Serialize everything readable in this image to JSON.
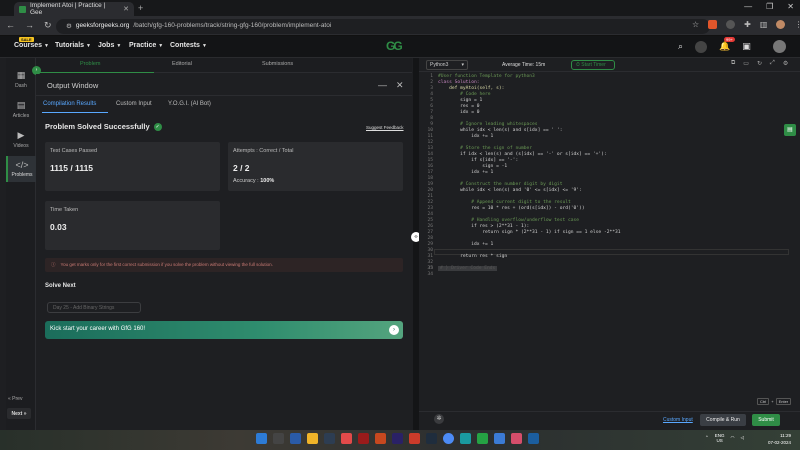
{
  "browser": {
    "tab_title": "Implement Atoi | Practice | Gee",
    "url_host": "geeksforgeeks.org",
    "url_path": "/batch/gfg-160-problems/track/string-gfg-160/problem/implement-atoi"
  },
  "site_nav": {
    "sale_badge": "SALE",
    "menus": [
      "Courses",
      "Tutorials",
      "Jobs",
      "Practice",
      "Contests"
    ],
    "logo": "GG",
    "notif_count": "99+"
  },
  "sidebar": {
    "items": [
      {
        "label": "Dash",
        "icon": "dash-icon"
      },
      {
        "label": "Articles",
        "icon": "articles-icon"
      },
      {
        "label": "Videos",
        "icon": "videos-icon"
      },
      {
        "label": "Problems",
        "icon": "code-icon"
      }
    ],
    "prev": "« Prev",
    "next": "Next »"
  },
  "problem_tabs": [
    "Problem",
    "Editorial",
    "Submissions"
  ],
  "output": {
    "title": "Output Window",
    "tabs": [
      "Compilation Results",
      "Custom Input",
      "Y.O.G.I. (AI Bot)"
    ],
    "status": "Problem Solved Successfully",
    "suggest_feedback": "Suggest Feedback",
    "test_cases_label": "Test Cases Passed",
    "test_cases_value": "1115 / 1115",
    "attempts_label": "Attempts : Correct / Total",
    "attempts_value": "2 / 2",
    "accuracy_label": "Accuracy :",
    "accuracy_value": "100%",
    "time_label": "Time Taken",
    "time_value": "0.03",
    "warning": "You get marks only for the first correct submission if you solve the problem without viewing the full solution.",
    "solve_next": "Solve Next",
    "next_problem": "Day 25 - Add Binary Strings",
    "banner": "Kick start your career with GfG 160!"
  },
  "editor": {
    "language": "Python3",
    "avg_time": "Average Time: 15m",
    "timer": "Start Timer",
    "custom_input": "Custom Input",
    "compile_run": "Compile & Run",
    "submit": "Submit",
    "shortcut_1": "Ctrl",
    "shortcut_2": "Enter",
    "ghost_line": "# } Driver Code Ends"
  },
  "code_lines": [
    {
      "n": "1",
      "t": "#User function Template for python3",
      "c": "cm"
    },
    {
      "n": "2",
      "t": "class Solution:",
      "c": "kw"
    },
    {
      "n": "3",
      "t": "    def myAtoi(self, s):",
      "c": "fn"
    },
    {
      "n": "4",
      "t": "        # Code here",
      "c": "cm"
    },
    {
      "n": "5",
      "t": "        sign = 1",
      "c": "tx"
    },
    {
      "n": "6",
      "t": "        res = 0",
      "c": "tx"
    },
    {
      "n": "7",
      "t": "        idx = 0",
      "c": "tx"
    },
    {
      "n": "8",
      "t": "",
      "c": "tx"
    },
    {
      "n": "9",
      "t": "        # Ignore leading whitespaces",
      "c": "cm"
    },
    {
      "n": "10",
      "t": "        while idx < len(s) and s[idx] == ' ':",
      "c": "tx"
    },
    {
      "n": "11",
      "t": "            idx += 1",
      "c": "tx"
    },
    {
      "n": "12",
      "t": "",
      "c": "tx"
    },
    {
      "n": "13",
      "t": "        # Store the sign of number",
      "c": "cm"
    },
    {
      "n": "14",
      "t": "        if idx < len(s) and (s[idx] == '-' or s[idx] == '+'):",
      "c": "tx"
    },
    {
      "n": "15",
      "t": "            if s[idx] == '-':",
      "c": "tx"
    },
    {
      "n": "16",
      "t": "                sign = -1",
      "c": "tx"
    },
    {
      "n": "17",
      "t": "            idx += 1",
      "c": "tx"
    },
    {
      "n": "18",
      "t": "",
      "c": "tx"
    },
    {
      "n": "19",
      "t": "        # Construct the number digit by digit",
      "c": "cm"
    },
    {
      "n": "20",
      "t": "        while idx < len(s) and '0' <= s[idx] <= '9':",
      "c": "tx"
    },
    {
      "n": "21",
      "t": "",
      "c": "tx"
    },
    {
      "n": "22",
      "t": "            # Append current digit to the result",
      "c": "cm"
    },
    {
      "n": "23",
      "t": "            res = 10 * res + (ord(s[idx]) - ord('0'))",
      "c": "tx"
    },
    {
      "n": "24",
      "t": "",
      "c": "tx"
    },
    {
      "n": "25",
      "t": "            # Handling overflow/underflow test case",
      "c": "cm"
    },
    {
      "n": "26",
      "t": "            if res > (2**31 - 1):",
      "c": "tx"
    },
    {
      "n": "27",
      "t": "                return sign * (2**31 - 1) if sign == 1 else -2**31",
      "c": "tx"
    },
    {
      "n": "28",
      "t": "",
      "c": "tx"
    },
    {
      "n": "29",
      "t": "            idx += 1",
      "c": "tx"
    },
    {
      "n": "30",
      "t": "",
      "c": "tx"
    },
    {
      "n": "31",
      "t": "        return res * sign",
      "c": "tx"
    },
    {
      "n": "32",
      "t": "",
      "c": "tx"
    },
    {
      "n": "33",
      "t": "",
      "c": "tx"
    },
    {
      "n": "34",
      "t": "",
      "c": "tx"
    }
  ],
  "taskbar": {
    "lang": "ENG",
    "region": "US",
    "time": "11:29",
    "date": "07-02-2024"
  },
  "colors": {
    "accent": "#2f8d46",
    "link": "#59a8ff",
    "bg": "#1e1f22"
  }
}
